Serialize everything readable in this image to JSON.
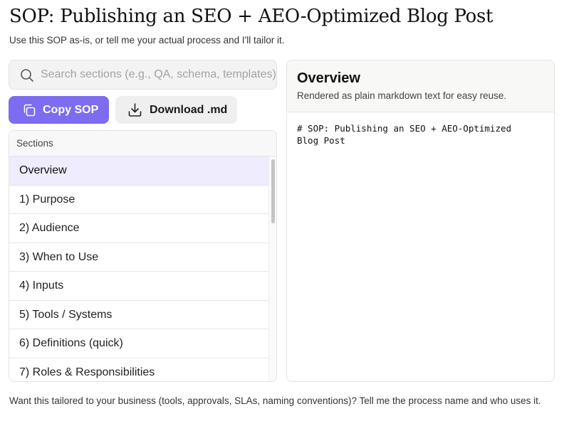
{
  "header": {
    "title": "SOP: Publishing an SEO + AEO-Optimized Blog Post",
    "subtitle": "Use this SOP as-is, or tell me your actual process and I'll tailor it."
  },
  "search": {
    "placeholder": "Search sections (e.g., QA, schema, templates)",
    "value": "",
    "icon": "search-icon"
  },
  "actions": {
    "copy_label": "Copy SOP",
    "copy_icon": "copy-icon",
    "download_label": "Download .md",
    "download_icon": "download-icon"
  },
  "sections": {
    "heading": "Sections",
    "items": [
      {
        "label": "Overview",
        "active": true
      },
      {
        "label": "1) Purpose",
        "active": false
      },
      {
        "label": "2) Audience",
        "active": false
      },
      {
        "label": "3) When to Use",
        "active": false
      },
      {
        "label": "4) Inputs",
        "active": false
      },
      {
        "label": "5) Tools / Systems",
        "active": false
      },
      {
        "label": "6) Definitions (quick)",
        "active": false
      },
      {
        "label": "7) Roles & Responsibilities",
        "active": false
      }
    ]
  },
  "panel": {
    "title": "Overview",
    "subtitle": "Rendered as plain markdown text for easy reuse.",
    "content": "# SOP: Publishing an SEO + AEO-Optimized\nBlog Post"
  },
  "footer": {
    "text": "Want this tailored to your business (tools, approvals, SLAs, naming conventions)? Tell me the process name and who uses it."
  },
  "colors": {
    "accent": "#7c6cf0",
    "active_row": "#eeecfd"
  }
}
